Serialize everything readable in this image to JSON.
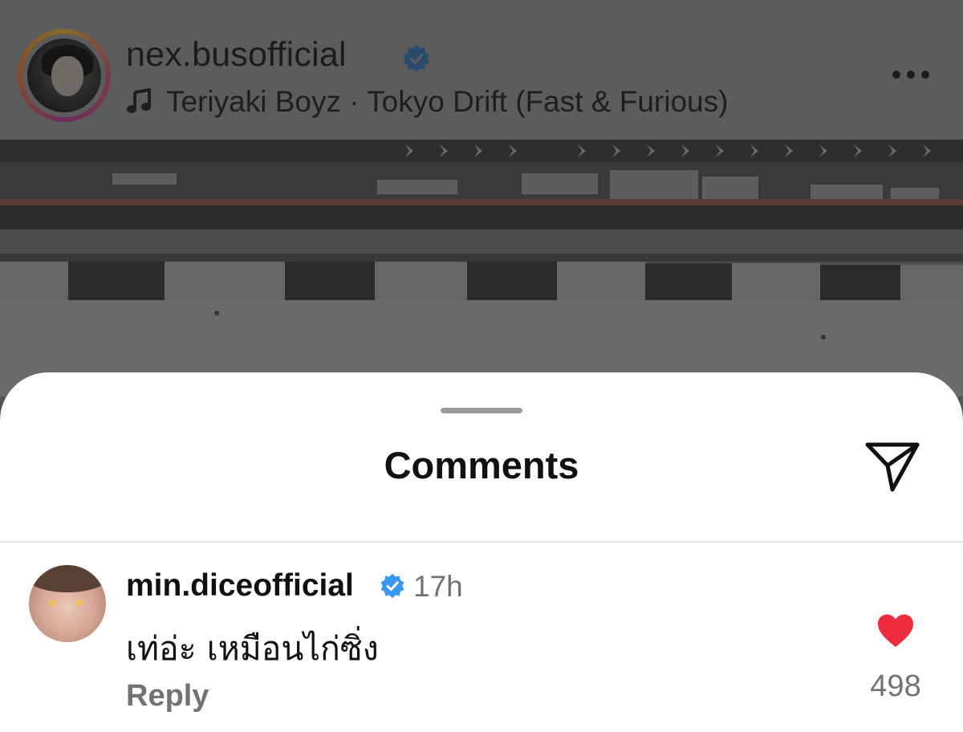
{
  "post": {
    "username": "nex.busofficial",
    "audio": "Teriyaki Boyz · Tokyo Drift (Fast & Furious)"
  },
  "sheet": {
    "title": "Comments"
  },
  "comment": {
    "username": "min.diceofficial",
    "time": "17h",
    "text": "เท่อ่ะ เหมือนไก่ซิ่ง",
    "reply_label": "Reply",
    "likes": "498"
  },
  "colors": {
    "verified": "#3897f0",
    "like": "#ed2c3e",
    "secondary_text": "#737373"
  },
  "icons": [
    "music-note-icon",
    "verified-badge-icon",
    "more-options-icon",
    "share-send-icon",
    "heart-icon"
  ]
}
